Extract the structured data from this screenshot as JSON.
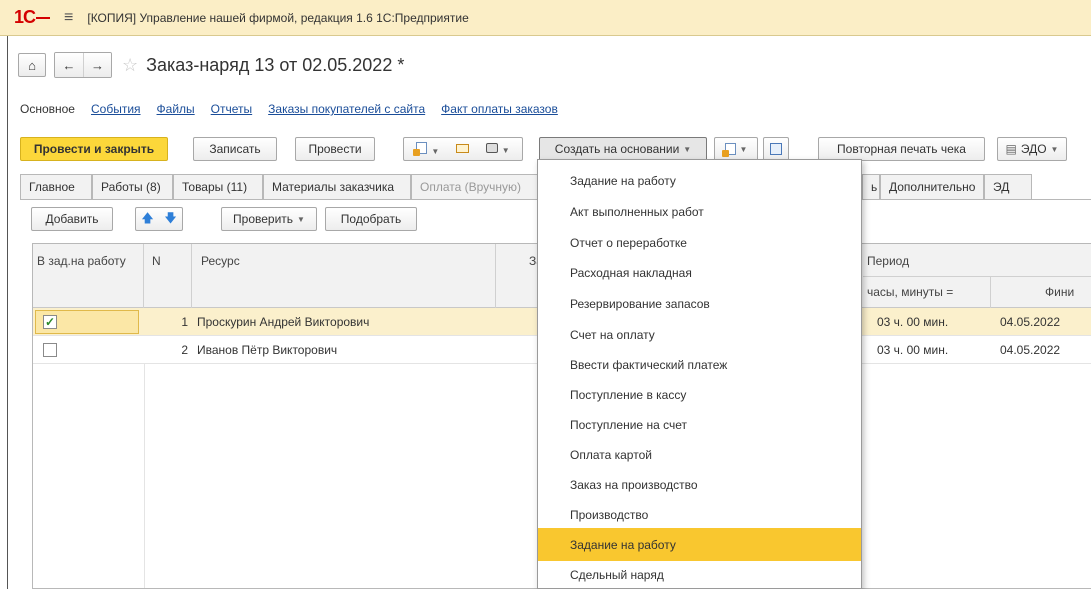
{
  "app": {
    "logo": "1С",
    "title": "[КОПИЯ] Управление нашей фирмой, редакция 1.6 1С:Предприятие"
  },
  "nav": {
    "home_icon": "home-icon",
    "back_icon": "arrow-left-icon",
    "forward_icon": "arrow-right-icon",
    "favorite_icon": "star-icon",
    "doc_title": "Заказ-наряд 13 от 02.05.2022 *"
  },
  "sections": {
    "main": "Основное",
    "links": [
      "События",
      "Файлы",
      "Отчеты",
      "Заказы покупателей с сайта",
      "Факт оплаты заказов"
    ]
  },
  "toolbar": {
    "post_close": "Провести и закрыть",
    "save": "Записать",
    "post": "Провести",
    "create_based": "Создать на основании",
    "reprint": "Повторная печать чека",
    "edo": "ЭДО"
  },
  "tabs": [
    "Главное",
    "Работы (8)",
    "Товары (11)",
    "Материалы заказчика",
    "Оплата (Вручную)",
    "ь",
    "Дополнительно",
    "ЭД"
  ],
  "subtoolbar": {
    "add": "Добавить",
    "check": "Проверить",
    "pick": "Подобрать"
  },
  "grid": {
    "headers": {
      "in_task": "В зад.на работу",
      "n": "N",
      "resource": "Ресурс",
      "partial": "За",
      "period": "Период",
      "hours": "часы, минуты =",
      "finish": "Фини"
    },
    "rows": [
      {
        "checked": true,
        "n": "1",
        "resource": "Проскурин Андрей Викторович",
        "hours": "03 ч. 00 мин.",
        "date": "04.05.2022"
      },
      {
        "checked": false,
        "n": "2",
        "resource": "Иванов Пётр Викторович",
        "hours": "03 ч. 00 мин.",
        "date": "04.05.2022"
      }
    ]
  },
  "dropdown": {
    "items": [
      "Задание на работу",
      "Акт выполненных работ",
      "Отчет о переработке",
      "Расходная накладная",
      "Резервирование запасов",
      "Счет на оплату",
      "Ввести фактический платеж",
      "Поступление в кассу",
      "Поступление на счет",
      "Оплата картой",
      "Заказ на производство",
      "Производство",
      "Задание на работу",
      "Сдельный наряд"
    ],
    "highlighted_index": 12
  }
}
